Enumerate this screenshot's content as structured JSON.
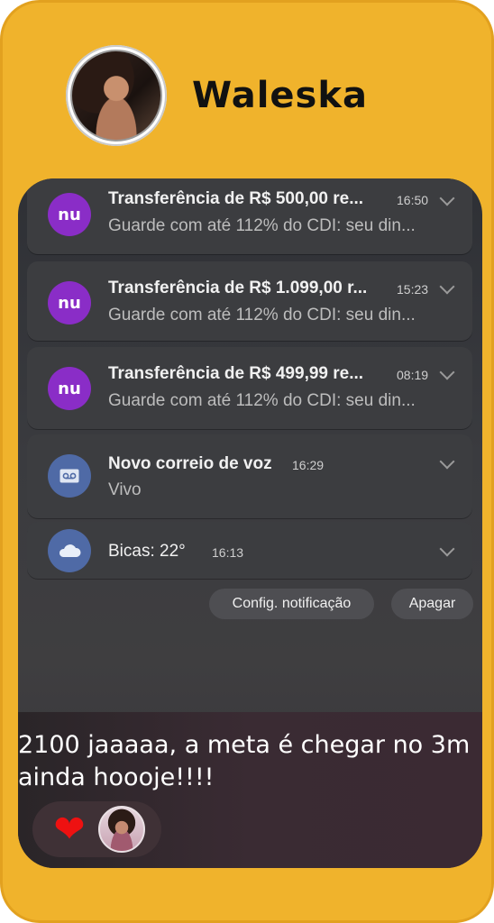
{
  "profile": {
    "name": "Waleska"
  },
  "notifications": [
    {
      "icon": "nubank-icon",
      "icon_text": "nu",
      "title": "Transferência de R$ 500,00 re...",
      "time": "16:50",
      "body": "Guarde com até 112% do CDI: seu din..."
    },
    {
      "icon": "nubank-icon",
      "icon_text": "nu",
      "title": "Transferência de R$ 1.099,00 r...",
      "time": "15:23",
      "body": "Guarde com até 112% do CDI: seu din..."
    },
    {
      "icon": "nubank-icon",
      "icon_text": "nu",
      "title": "Transferência de R$ 499,99 re...",
      "time": "08:19",
      "body": "Guarde com até 112% do CDI: seu din..."
    },
    {
      "icon": "voicemail-icon",
      "title": "Novo correio de voz",
      "time": "16:29",
      "body": "Vivo"
    },
    {
      "icon": "cloud-icon",
      "title": "Bicas: 22°",
      "time": "16:13"
    }
  ],
  "actions": {
    "settings": "Config. notificação",
    "clear": "Apagar"
  },
  "caption": {
    "line1": "2100 jaaaaa, a meta é chegar no 3m",
    "line2": "ainda hoooje!!!!"
  },
  "reactions": {
    "heart": "❤"
  },
  "colors": {
    "frame": "#f0b32c",
    "nubank": "#8a2dc7",
    "system_icon": "#4f6aa6"
  }
}
